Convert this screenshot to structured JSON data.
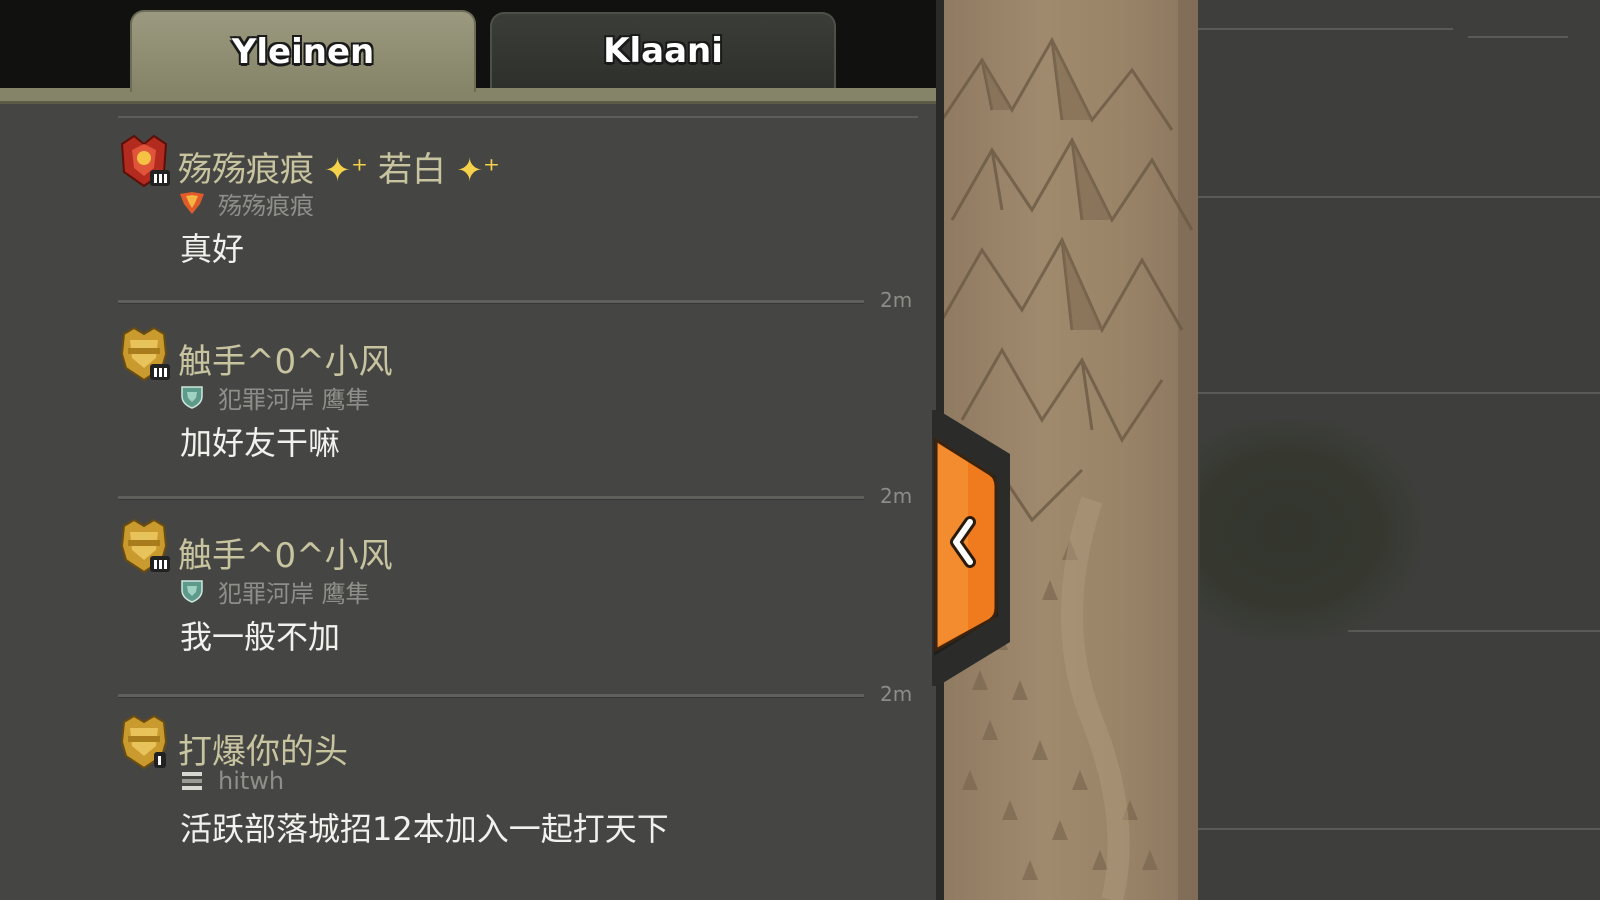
{
  "tabs": [
    {
      "label": "Yleinen",
      "active": true
    },
    {
      "label": "Klaani",
      "active": false
    }
  ],
  "messages": [
    {
      "username": "殇殇痕痕",
      "username_suffix": "若白",
      "clan": "殇殇痕痕",
      "text": "真好",
      "time": "2m",
      "league_icon": "legend-league-icon",
      "clan_icon": "red-clan-badge-icon"
    },
    {
      "username": "触手^0^小风",
      "clan": "犯罪河岸 鹰隼",
      "text": "加好友干嘛",
      "time": "2m",
      "league_icon": "champion-league-icon",
      "clan_icon": "green-clan-badge-icon"
    },
    {
      "username": "触手^0^小风",
      "clan": "犯罪河岸 鹰隼",
      "text": "我一般不加",
      "time": "2m",
      "league_icon": "champion-league-icon",
      "clan_icon": "green-clan-badge-icon"
    },
    {
      "username": "打爆你的头",
      "clan": "hitwh",
      "text": "活跃部落城招12本加入一起打天下",
      "league_icon": "champion-league-icon",
      "clan_icon": "striped-clan-badge-icon"
    }
  ],
  "collapse_button": {
    "icon": "chevron-left-icon"
  },
  "colors": {
    "tab_active": "#858468",
    "username": "#c8c4a0",
    "message": "#f1f1ee",
    "button_orange": "#f07a1e"
  }
}
